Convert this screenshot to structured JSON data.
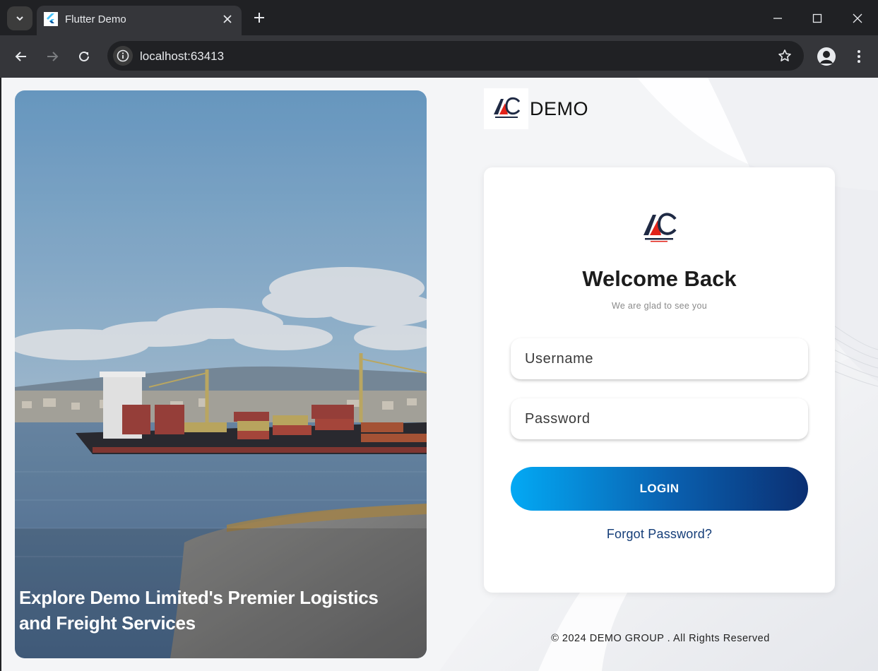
{
  "browser": {
    "tab_title": "Flutter Demo",
    "url": "localhost:63413"
  },
  "icons": {
    "tab_search": "chevron-down-icon",
    "favicon": "flutter-icon",
    "tab_close": "close-icon",
    "new_tab": "plus-icon",
    "minimize": "minimize-icon",
    "maximize": "maximize-icon",
    "window_close": "close-icon",
    "back": "arrow-left-icon",
    "forward": "arrow-right-icon",
    "reload": "reload-icon",
    "site_info": "info-icon",
    "bookmark": "star-icon",
    "profile": "profile-icon",
    "menu": "kebab-icon"
  },
  "hero": {
    "caption": "Explore Demo Limited's Premier Logistics and Freight Services"
  },
  "brand": {
    "name": "DEMO"
  },
  "login": {
    "title": "Welcome Back",
    "subtitle": "We are glad to see you",
    "username_placeholder": "Username",
    "username_value": "",
    "password_placeholder": "Password",
    "password_value": "",
    "button_label": "LOGIN",
    "forgot_label": "Forgot Password?"
  },
  "footer": {
    "text": "© 2024 DEMO GROUP . All Rights Reserved"
  },
  "colors": {
    "gradient_start": "#03a9f4",
    "gradient_end": "#0b2f72",
    "link": "#143d78",
    "logo_red": "#e2231a",
    "logo_navy": "#1f2a44"
  }
}
